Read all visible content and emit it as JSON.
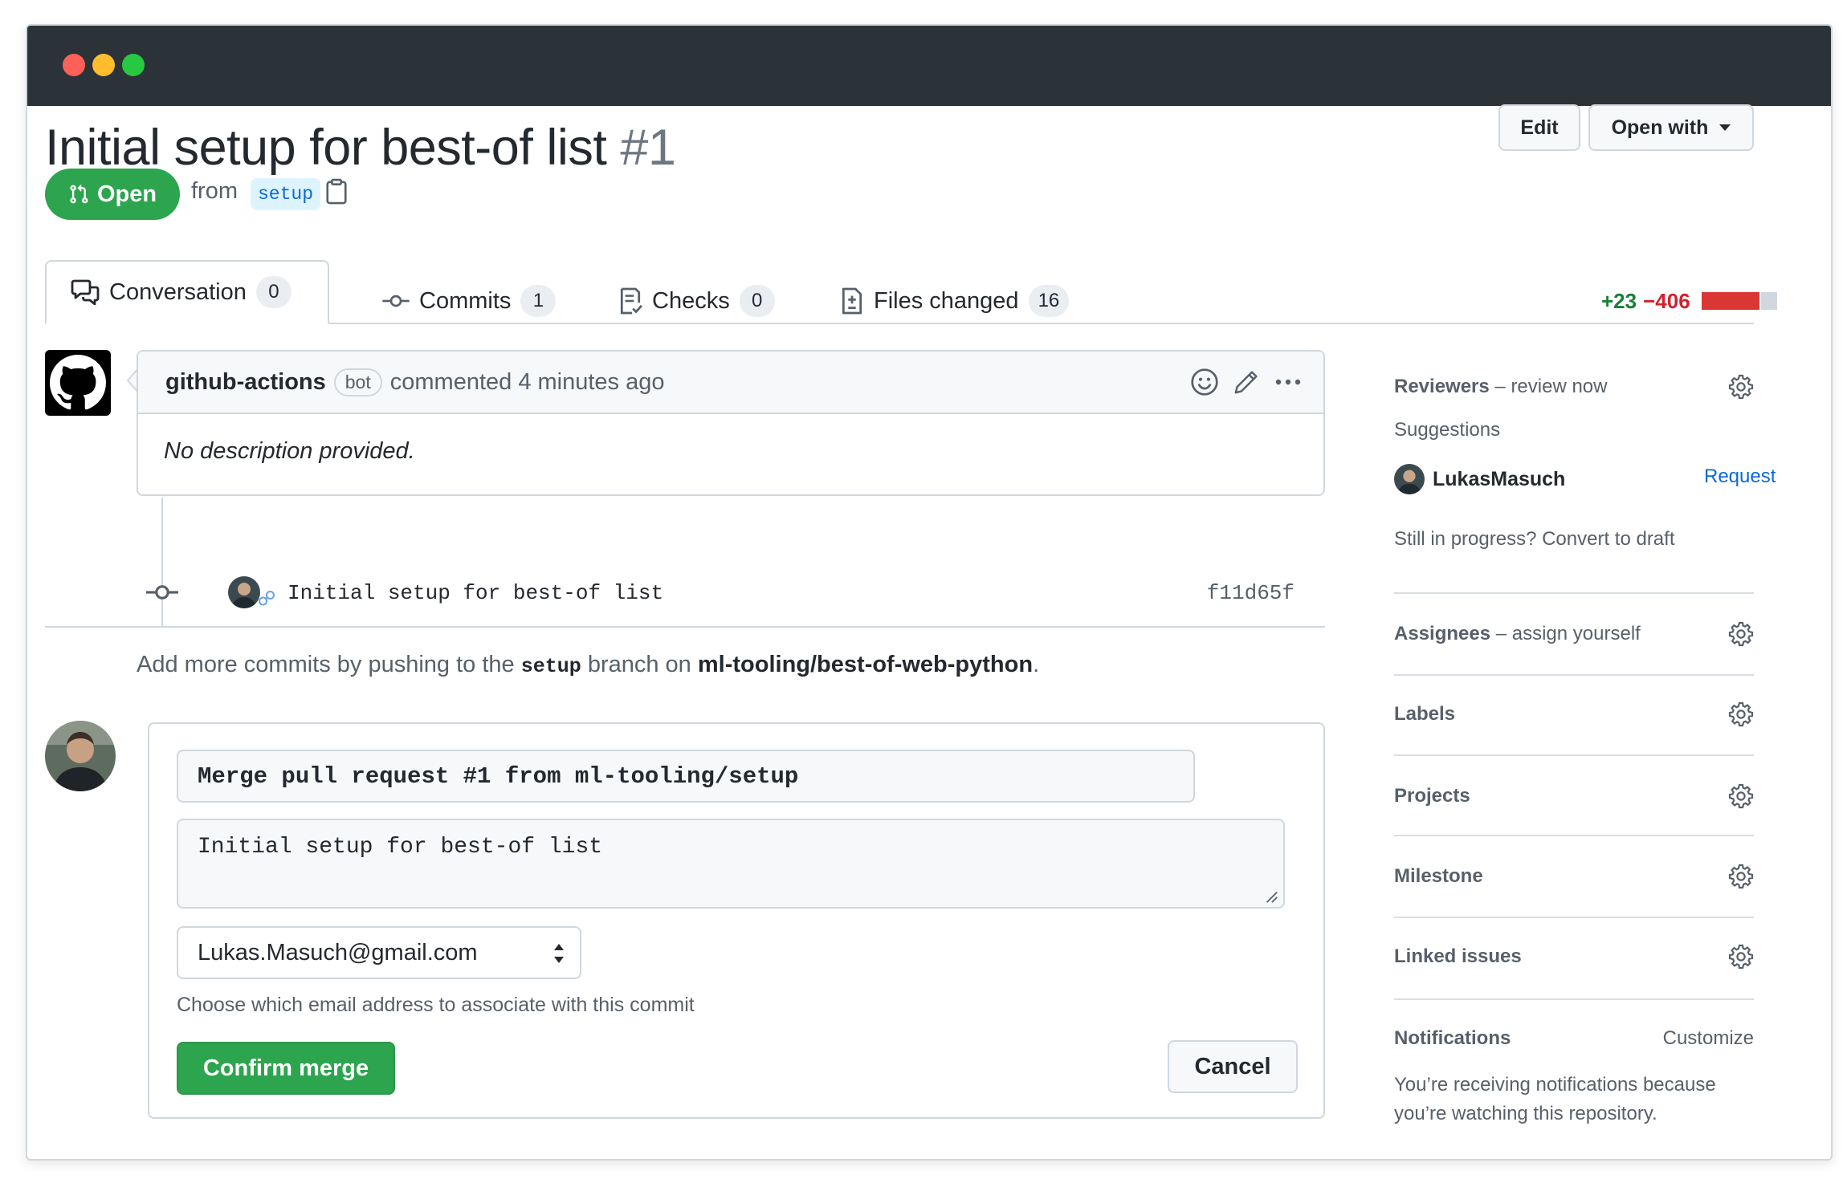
{
  "pr": {
    "title": "Initial setup for best-of list",
    "number": "#1",
    "state": "Open",
    "from_label": "from",
    "branch": "setup"
  },
  "header_actions": {
    "edit": "Edit",
    "open_with": "Open with"
  },
  "tabs": [
    {
      "label": "Conversation",
      "count": "0"
    },
    {
      "label": "Commits",
      "count": "1"
    },
    {
      "label": "Checks",
      "count": "0"
    },
    {
      "label": "Files changed",
      "count": "16"
    }
  ],
  "diffstat": {
    "additions": "+23",
    "deletions": "−406",
    "add_fraction": 0.05
  },
  "comment": {
    "author": "github-actions",
    "badge": "bot",
    "action": "commented 4 minutes ago",
    "body": "No description provided."
  },
  "commit": {
    "message": "Initial setup for best-of list",
    "sha": "f11d65f"
  },
  "add_more": {
    "prefix": "Add more commits by pushing to the",
    "branch": "setup",
    "middle": "branch on",
    "repo": "ml-tooling/best-of-web-python",
    "suffix": "."
  },
  "merge": {
    "title": "Merge pull request #1 from ml-tooling/setup",
    "body": "Initial setup for best-of list",
    "email": "Lukas.Masuch@gmail.com",
    "email_note": "Choose which email address to associate with this commit",
    "confirm": "Confirm merge",
    "cancel": "Cancel"
  },
  "sidebar": {
    "reviewers_label": "Reviewers",
    "reviewers_hint": "– review now",
    "suggestions": "Suggestions",
    "suggested_user": "LukasMasuch",
    "request": "Request",
    "draft": "Still in progress? Convert to draft",
    "assignees_label": "Assignees",
    "assignees_hint": "– assign yourself",
    "labels": "Labels",
    "projects": "Projects",
    "milestone": "Milestone",
    "linked_issues": "Linked issues",
    "notifications": "Notifications",
    "customize": "Customize",
    "notifications_text": "You’re receiving notifications because you’re watching this repository."
  },
  "colors": {
    "open_green": "#2da44e",
    "titlebar": "#2c3338",
    "link_blue": "#0969da",
    "deletion_red": "#cf222e"
  },
  "icons": [
    "git-pull-request-icon",
    "clipboard-icon",
    "comment-discussion-icon",
    "git-commit-icon",
    "checklist-icon",
    "file-diff-icon",
    "smiley-icon",
    "pencil-icon",
    "kebab-horizontal-icon",
    "gear-icon",
    "github-logo"
  ]
}
